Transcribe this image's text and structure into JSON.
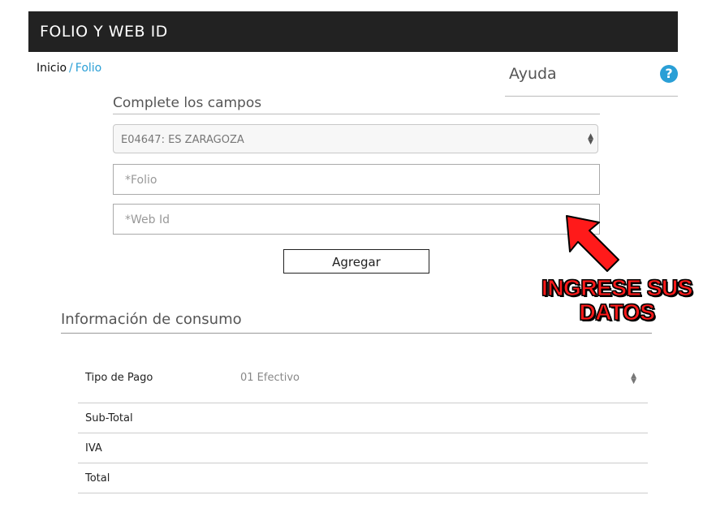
{
  "header": {
    "title": "FOLIO Y WEB ID"
  },
  "breadcrumb": {
    "home": "Inicio",
    "separator": "/",
    "current": "Folio"
  },
  "help": {
    "title": "Ayuda",
    "icon": "question-icon",
    "icon_glyph": "?"
  },
  "form": {
    "title": "Complete los campos",
    "store_select": {
      "value": "E04647: ES ZARAGOZA"
    },
    "folio_placeholder": "*Folio",
    "webid_placeholder": "*Web Id",
    "submit_label": "Agregar"
  },
  "consumo": {
    "title": "Información de consumo",
    "tipo_pago_label": "Tipo de Pago",
    "tipo_pago_value": "01 Efectivo",
    "subtotal_label": "Sub-Total",
    "iva_label": "IVA",
    "total_label": "Total"
  },
  "annotation": {
    "line1": "INGRESE SUS",
    "line2": "DATOS",
    "color": "#ff1a1a"
  },
  "colors": {
    "accent": "#2a9fd6",
    "header_bg": "#222222"
  }
}
